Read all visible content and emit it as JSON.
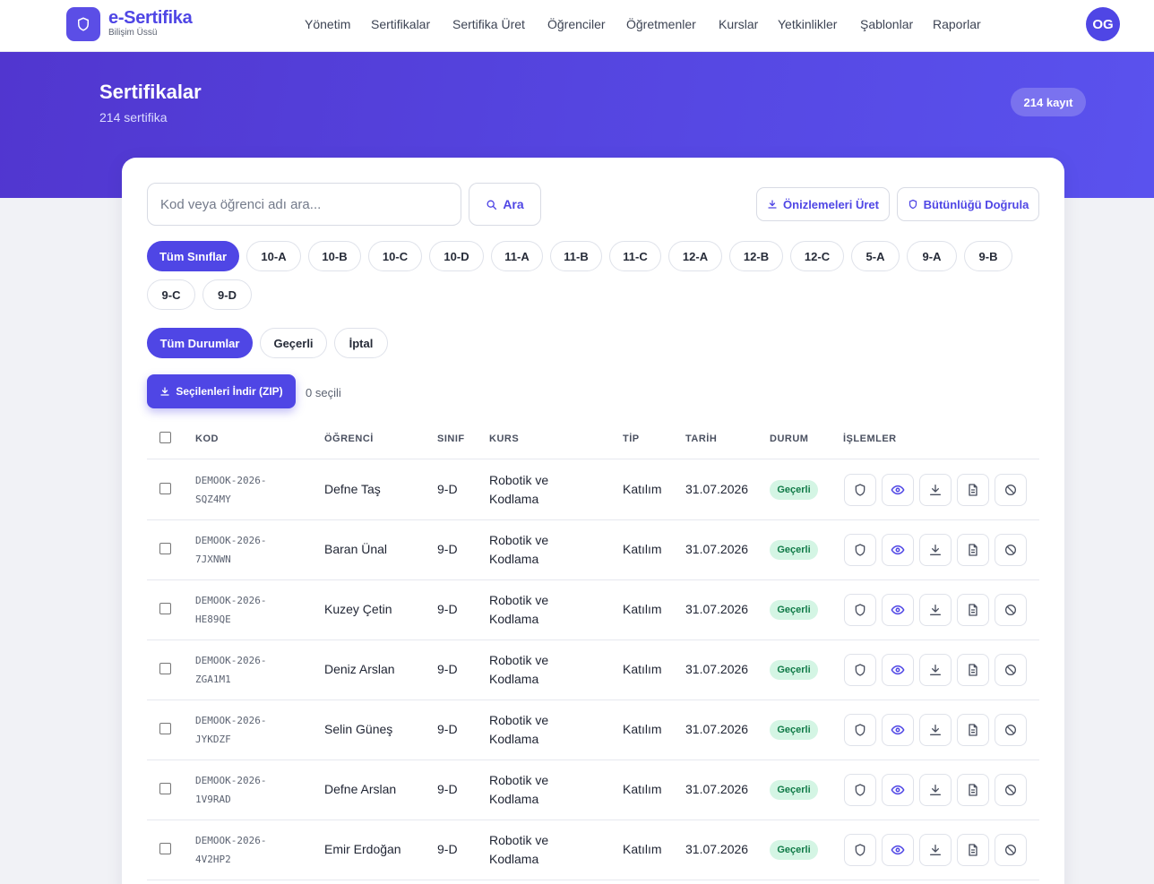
{
  "brand": {
    "name": "e-Sertifika",
    "subtitle": "Bilişim Üssü"
  },
  "nav": [
    "Yönetim",
    "Sertifikalar",
    "Sertifika Üret",
    "Öğrenciler",
    "Öğretmenler",
    "Kurslar",
    "Yetkinlikler",
    "Şablonlar",
    "Raporlar"
  ],
  "user": {
    "initials": "OG"
  },
  "hero": {
    "title": "Sertifikalar",
    "subtitle": "214 sertifika",
    "badge": "214 kayıt"
  },
  "search": {
    "placeholder": "Kod veya öğrenci adı ara...",
    "button": "Ara"
  },
  "actions": {
    "previews": "Önizlemeleri Üret",
    "verify": "Bütünlüğü Doğrula"
  },
  "class_filters": [
    "Tüm Sınıflar",
    "10-A",
    "10-B",
    "10-C",
    "10-D",
    "11-A",
    "11-B",
    "11-C",
    "12-A",
    "12-B",
    "12-C",
    "5-A",
    "9-A",
    "9-B",
    "9-C",
    "9-D"
  ],
  "status_filters": [
    "Tüm Durumlar",
    "Geçerli",
    "İptal"
  ],
  "bulk": {
    "download_label": "Seçilenleri İndir (ZIP)",
    "selected_text": "0 seçili"
  },
  "table": {
    "headers": [
      "KOD",
      "ÖĞRENCİ",
      "SINIF",
      "KURS",
      "TİP",
      "TARİH",
      "DURUM",
      "İŞLEMLER"
    ],
    "rows": [
      {
        "code1": "DEMOOK-2026-",
        "code2": "SQZ4MY",
        "student": "Defne Taş",
        "class": "9-D",
        "course1": "Robotik ve",
        "course2": "Kodlama",
        "type": "Katılım",
        "date": "31.07.2026",
        "status": "Geçerli"
      },
      {
        "code1": "DEMOOK-2026-",
        "code2": "7JXNWN",
        "student": "Baran Ünal",
        "class": "9-D",
        "course1": "Robotik ve",
        "course2": "Kodlama",
        "type": "Katılım",
        "date": "31.07.2026",
        "status": "Geçerli"
      },
      {
        "code1": "DEMOOK-2026-",
        "code2": "HE89QE",
        "student": "Kuzey Çetin",
        "class": "9-D",
        "course1": "Robotik ve",
        "course2": "Kodlama",
        "type": "Katılım",
        "date": "31.07.2026",
        "status": "Geçerli"
      },
      {
        "code1": "DEMOOK-2026-",
        "code2": "ZGA1M1",
        "student": "Deniz Arslan",
        "class": "9-D",
        "course1": "Robotik ve",
        "course2": "Kodlama",
        "type": "Katılım",
        "date": "31.07.2026",
        "status": "Geçerli"
      },
      {
        "code1": "DEMOOK-2026-",
        "code2": "JYKDZF",
        "student": "Selin Güneş",
        "class": "9-D",
        "course1": "Robotik ve",
        "course2": "Kodlama",
        "type": "Katılım",
        "date": "31.07.2026",
        "status": "Geçerli"
      },
      {
        "code1": "DEMOOK-2026-",
        "code2": "1V9RAD",
        "student": "Defne Arslan",
        "class": "9-D",
        "course1": "Robotik ve",
        "course2": "Kodlama",
        "type": "Katılım",
        "date": "31.07.2026",
        "status": "Geçerli"
      },
      {
        "code1": "DEMOOK-2026-",
        "code2": "4V2HP2",
        "student": "Emir Erdoğan",
        "class": "9-D",
        "course1": "Robotik ve",
        "course2": "Kodlama",
        "type": "Katılım",
        "date": "31.07.2026",
        "status": "Geçerli"
      }
    ]
  },
  "row_actions": [
    "shield-icon",
    "eye-icon",
    "download-icon",
    "document-icon",
    "ban-icon"
  ],
  "colors": {
    "primary": "#4f46e5",
    "success_bg": "#d4f5e4",
    "success_text": "#107a47"
  }
}
